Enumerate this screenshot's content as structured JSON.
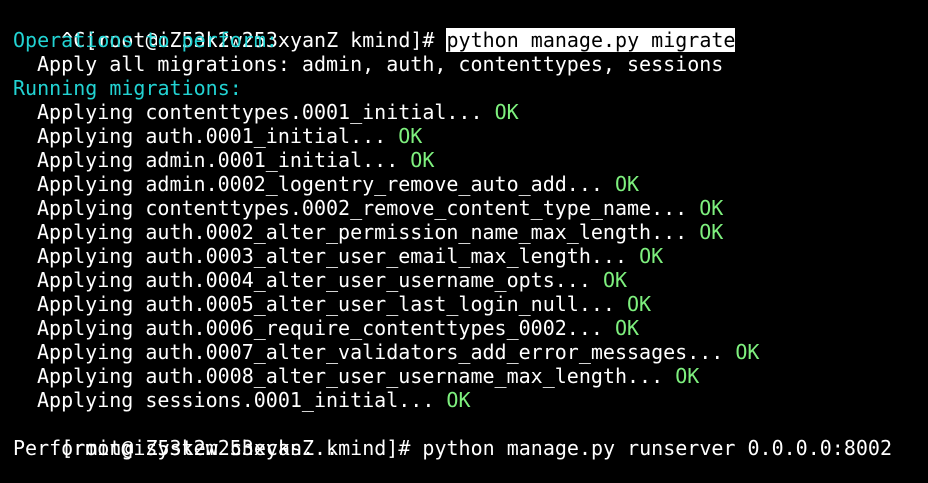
{
  "colors": {
    "background": "#000000",
    "text": "#ffffff",
    "heading": "#22d3d3",
    "success": "#7ef07e",
    "selection_background": "#ffffff",
    "selection_text": "#000000"
  },
  "terminal": {
    "first_prompt": {
      "prefix": "^C[root@iZ53k2w253xyanZ kmind]# ",
      "command": "python manage.py migrate"
    },
    "operations_heading": "Operations to perform:",
    "apply_line": "Apply all migrations: admin, auth, contenttypes, sessions",
    "running_heading": "Running migrations:",
    "migrations": [
      {
        "text": "Applying contenttypes.0001_initial... ",
        "status": "OK"
      },
      {
        "text": "Applying auth.0001_initial... ",
        "status": "OK"
      },
      {
        "text": "Applying admin.0001_initial... ",
        "status": "OK"
      },
      {
        "text": "Applying admin.0002_logentry_remove_auto_add... ",
        "status": "OK"
      },
      {
        "text": "Applying contenttypes.0002_remove_content_type_name... ",
        "status": "OK"
      },
      {
        "text": "Applying auth.0002_alter_permission_name_max_length... ",
        "status": "OK"
      },
      {
        "text": "Applying auth.0003_alter_user_email_max_length... ",
        "status": "OK"
      },
      {
        "text": "Applying auth.0004_alter_user_username_opts... ",
        "status": "OK"
      },
      {
        "text": "Applying auth.0005_alter_user_last_login_null... ",
        "status": "OK"
      },
      {
        "text": "Applying auth.0006_require_contenttypes_0002... ",
        "status": "OK"
      },
      {
        "text": "Applying auth.0007_alter_validators_add_error_messages... ",
        "status": "OK"
      },
      {
        "text": "Applying auth.0008_alter_user_username_max_length... ",
        "status": "OK"
      },
      {
        "text": "Applying sessions.0001_initial... ",
        "status": "OK"
      }
    ],
    "second_prompt": {
      "prefix": "[root@iZ53k2w253xyanZ kmind]# ",
      "command": "python manage.py runserver 0.0.0.0:8002"
    },
    "last_output": "Performing system checks..."
  }
}
